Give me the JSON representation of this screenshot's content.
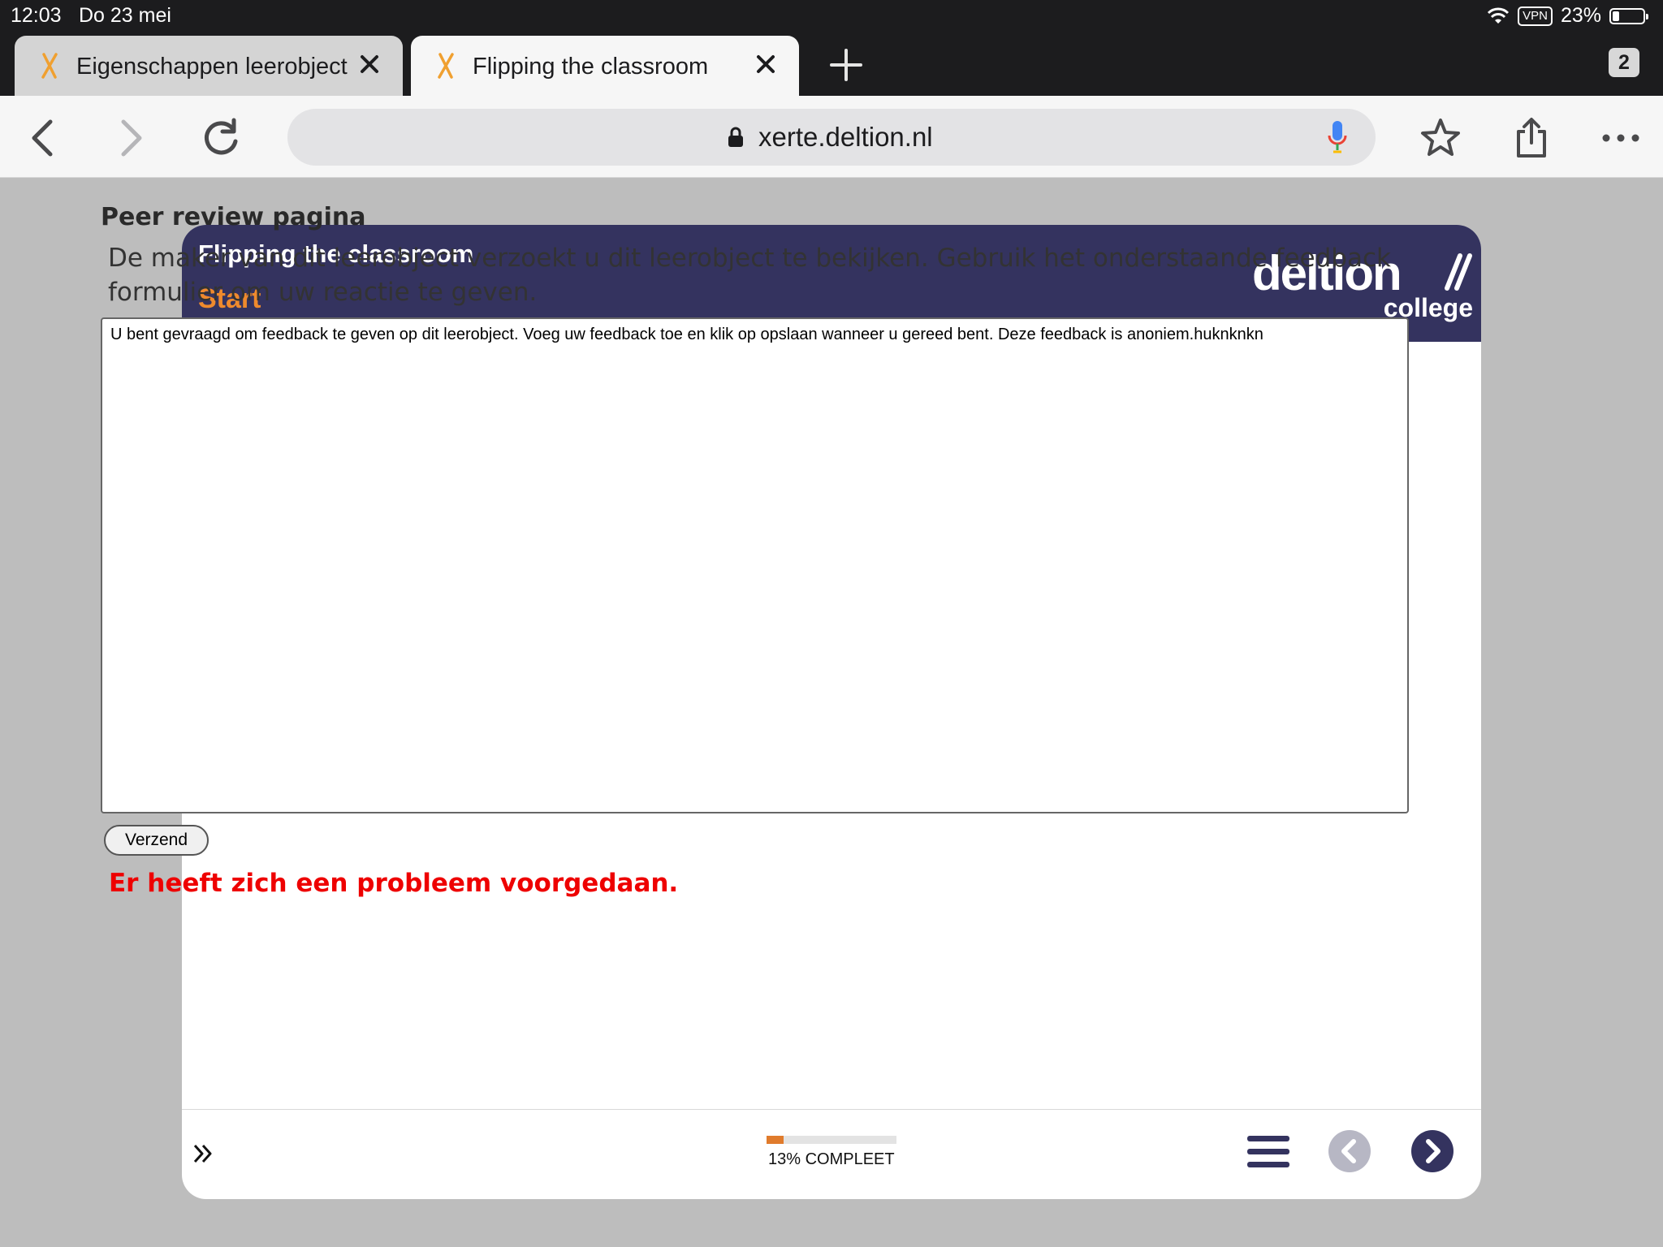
{
  "status_bar": {
    "time": "12:03",
    "date": "Do 23 mei",
    "vpn": "VPN",
    "battery": "23%"
  },
  "browser": {
    "tabs": [
      {
        "title": "Eigenschappen leerobject",
        "active": false
      },
      {
        "title": "Flipping the classroom",
        "active": true
      }
    ],
    "tab_count": "2",
    "url": "xerte.deltion.nl",
    "icons": [
      "back-icon",
      "forward-icon",
      "reload-icon",
      "lock-icon",
      "microphone-icon",
      "bookmark-star-icon",
      "share-icon",
      "more-icon",
      "close-icon",
      "plus-icon",
      "xerte-favicon"
    ]
  },
  "learning_object": {
    "title": "Flipping the classroom",
    "subtitle": "Start",
    "brand": {
      "name": "deltion",
      "sub": "college"
    },
    "progress": {
      "percent": 13,
      "label": "13% COMPLEET"
    },
    "colors": {
      "header": "#34335f",
      "accent": "#ef8a2d",
      "progress_fill": "#e07b2c"
    }
  },
  "peer_review": {
    "heading": "Peer review pagina",
    "intro": "De maker van dit leerobject verzoekt u dit leerobject te bekijken. Gebruik het onderstaande feedback formulier om uw reactie te geven.",
    "textarea_value": "U bent gevraagd om feedback te geven op dit leerobject. Voeg uw feedback toe en klik op opslaan wanneer u gereed bent. Deze feedback is anoniem.huknknkn",
    "submit_label": "Verzend",
    "error": "Er heeft zich een probleem voorgedaan.",
    "error_color": "#ee0000"
  }
}
